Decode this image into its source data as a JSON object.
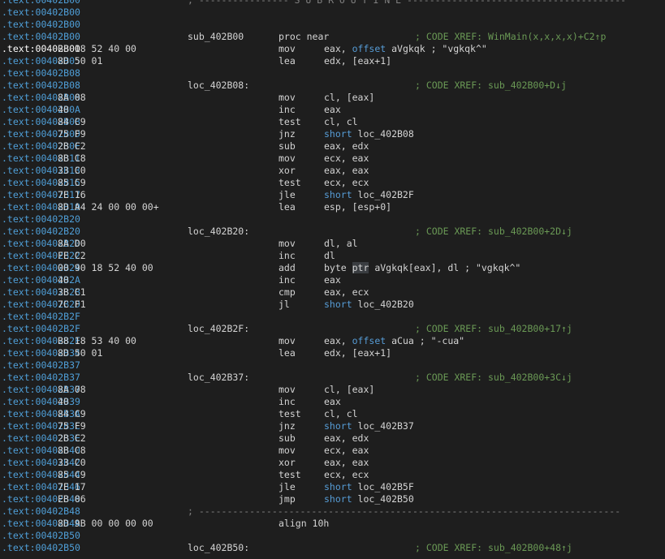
{
  "lines": [
    {
      "addr": ".text:00402B00",
      "sep": "; ---------------- S U B R O U T I N E ---------------------------------------"
    },
    {
      "addr": ".text:00402B00"
    },
    {
      "addr": ".text:00402B00"
    },
    {
      "addr": ".text:00402B00",
      "label": "sub_402B00",
      "mn": "proc near",
      "cm": "; CODE XREF: WinMain(x,x,x,x)+C2↑p"
    },
    {
      "addr": ".text:00402B00",
      "bytes": "B8 18 52 40 00",
      "mn": "mov",
      "op": [
        [
          "eax, ",
          ""
        ],
        [
          "offset",
          "kw"
        ],
        [
          " aVgkqk",
          ""
        ],
        [
          " ; \"vgkqk^\"",
          "str"
        ]
      ],
      "sel": true
    },
    {
      "addr": ".text:00402B05",
      "bytes": "8D 50 01",
      "mn": "lea",
      "op": [
        [
          "edx, [eax+1]",
          ""
        ]
      ]
    },
    {
      "addr": ".text:00402B08"
    },
    {
      "addr": ".text:00402B08",
      "label": "loc_402B08:",
      "cm": "; CODE XREF: sub_402B00+D↓j"
    },
    {
      "addr": ".text:00402B08",
      "bytes": "8A 08",
      "mn": "mov",
      "op": [
        [
          "cl, [eax]",
          ""
        ]
      ]
    },
    {
      "addr": ".text:00402B0A",
      "bytes": "40",
      "mn": "inc",
      "op": [
        [
          "eax",
          ""
        ]
      ]
    },
    {
      "addr": ".text:00402B0B",
      "bytes": "84 C9",
      "mn": "test",
      "op": [
        [
          "cl, cl",
          ""
        ]
      ]
    },
    {
      "addr": ".text:00402B0D",
      "bytes": "75 F9",
      "mn": "jnz",
      "op": [
        [
          "short",
          "kw"
        ],
        [
          " loc_402B08",
          ""
        ]
      ]
    },
    {
      "addr": ".text:00402B0F",
      "bytes": "2B C2",
      "mn": "sub",
      "op": [
        [
          "eax, edx",
          ""
        ]
      ]
    },
    {
      "addr": ".text:00402B11",
      "bytes": "8B C8",
      "mn": "mov",
      "op": [
        [
          "ecx, eax",
          ""
        ]
      ]
    },
    {
      "addr": ".text:00402B13",
      "bytes": "33 C0",
      "mn": "xor",
      "op": [
        [
          "eax, eax",
          ""
        ]
      ]
    },
    {
      "addr": ".text:00402B15",
      "bytes": "85 C9",
      "mn": "test",
      "op": [
        [
          "ecx, ecx",
          ""
        ]
      ]
    },
    {
      "addr": ".text:00402B17",
      "bytes": "7E 16",
      "mn": "jle",
      "op": [
        [
          "short",
          "kw"
        ],
        [
          " loc_402B2F",
          ""
        ]
      ]
    },
    {
      "addr": ".text:00402B19",
      "bytes": "8D A4 24 00 00 00+",
      "mn": "lea",
      "op": [
        [
          "esp, [esp+0]",
          ""
        ]
      ]
    },
    {
      "addr": ".text:00402B20"
    },
    {
      "addr": ".text:00402B20",
      "label": "loc_402B20:",
      "cm": "; CODE XREF: sub_402B00+2D↓j"
    },
    {
      "addr": ".text:00402B20",
      "bytes": "8A D0",
      "mn": "mov",
      "op": [
        [
          "dl, al",
          ""
        ]
      ]
    },
    {
      "addr": ".text:00402B22",
      "bytes": "FE C2",
      "mn": "inc",
      "op": [
        [
          "dl",
          ""
        ]
      ]
    },
    {
      "addr": ".text:00402B24",
      "bytes": "00 90 18 52 40 00",
      "mn": "add",
      "op": [
        [
          "byte ",
          ""
        ],
        [
          "ptr",
          "hl"
        ],
        [
          " aVgkqk[eax], dl",
          ""
        ],
        [
          " ; \"vgkqk^\"",
          "str"
        ]
      ]
    },
    {
      "addr": ".text:00402B2A",
      "bytes": "40",
      "mn": "inc",
      "op": [
        [
          "eax",
          ""
        ]
      ]
    },
    {
      "addr": ".text:00402B2B",
      "bytes": "3B C1",
      "mn": "cmp",
      "op": [
        [
          "eax, ecx",
          ""
        ]
      ]
    },
    {
      "addr": ".text:00402B2D",
      "bytes": "7C F1",
      "mn": "jl",
      "op": [
        [
          "short",
          "kw"
        ],
        [
          " loc_402B20",
          ""
        ]
      ]
    },
    {
      "addr": ".text:00402B2F"
    },
    {
      "addr": ".text:00402B2F",
      "label": "loc_402B2F:",
      "cm": "; CODE XREF: sub_402B00+17↑j"
    },
    {
      "addr": ".text:00402B2F",
      "bytes": "B8 18 53 40 00",
      "mn": "mov",
      "op": [
        [
          "eax, ",
          ""
        ],
        [
          "offset",
          "kw"
        ],
        [
          " aCua",
          ""
        ],
        [
          " ; \"-cua\"",
          "str"
        ]
      ]
    },
    {
      "addr": ".text:00402B34",
      "bytes": "8D 50 01",
      "mn": "lea",
      "op": [
        [
          "edx, [eax+1]",
          ""
        ]
      ]
    },
    {
      "addr": ".text:00402B37"
    },
    {
      "addr": ".text:00402B37",
      "label": "loc_402B37:",
      "cm": "; CODE XREF: sub_402B00+3C↓j"
    },
    {
      "addr": ".text:00402B37",
      "bytes": "8A 08",
      "mn": "mov",
      "op": [
        [
          "cl, [eax]",
          ""
        ]
      ]
    },
    {
      "addr": ".text:00402B39",
      "bytes": "40",
      "mn": "inc",
      "op": [
        [
          "eax",
          ""
        ]
      ]
    },
    {
      "addr": ".text:00402B3A",
      "bytes": "84 C9",
      "mn": "test",
      "op": [
        [
          "cl, cl",
          ""
        ]
      ]
    },
    {
      "addr": ".text:00402B3C",
      "bytes": "75 F9",
      "mn": "jnz",
      "op": [
        [
          "short",
          "kw"
        ],
        [
          " loc_402B37",
          ""
        ]
      ]
    },
    {
      "addr": ".text:00402B3E",
      "bytes": "2B C2",
      "mn": "sub",
      "op": [
        [
          "eax, edx",
          ""
        ]
      ]
    },
    {
      "addr": ".text:00402B40",
      "bytes": "8B C8",
      "mn": "mov",
      "op": [
        [
          "ecx, eax",
          ""
        ]
      ]
    },
    {
      "addr": ".text:00402B42",
      "bytes": "33 C0",
      "mn": "xor",
      "op": [
        [
          "eax, eax",
          ""
        ]
      ]
    },
    {
      "addr": ".text:00402B44",
      "bytes": "85 C9",
      "mn": "test",
      "op": [
        [
          "ecx, ecx",
          ""
        ]
      ]
    },
    {
      "addr": ".text:00402B46",
      "bytes": "7E 17",
      "mn": "jle",
      "op": [
        [
          "short",
          "kw"
        ],
        [
          " loc_402B5F",
          ""
        ]
      ]
    },
    {
      "addr": ".text:00402B48",
      "bytes": "EB 06",
      "mn": "jmp",
      "op": [
        [
          "short",
          "kw"
        ],
        [
          " loc_402B50",
          ""
        ]
      ]
    },
    {
      "addr": ".text:00402B48",
      "sep": "; ---------------------------------------------------------------------------"
    },
    {
      "addr": ".text:00402B4A",
      "bytes": "8D 9B 00 00 00 00",
      "mn": "align 10h"
    },
    {
      "addr": ".text:00402B50"
    },
    {
      "addr": ".text:00402B50",
      "label": "loc_402B50:",
      "cm": "; CODE XREF: sub_402B00+48↑j"
    }
  ]
}
